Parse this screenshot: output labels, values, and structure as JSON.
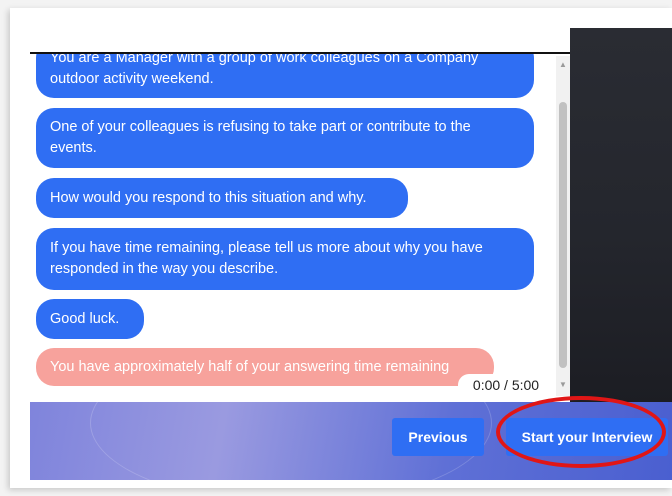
{
  "chat": {
    "messages": [
      {
        "text": "You are a Manager with a group of work colleagues on a Company outdoor activity weekend.",
        "kind": "info"
      },
      {
        "text": "One of your colleagues is refusing to take part or contribute to the events.",
        "kind": "info"
      },
      {
        "text": "How would you respond to this situation and why.",
        "kind": "info"
      },
      {
        "text": "If you have time remaining, please tell us more about why you have responded in the way you describe.",
        "kind": "info"
      },
      {
        "text": "Good luck.",
        "kind": "info"
      },
      {
        "text": "You have approximately half of your answering time remaining",
        "kind": "warning"
      }
    ]
  },
  "timer": {
    "label": "0:00 / 5:00"
  },
  "buttons": {
    "previous": "Previous",
    "start": "Start your Interview"
  },
  "colors": {
    "bubble": "#2f6ef3",
    "warning_bubble": "#f7a29c",
    "highlight_ring": "#e01616"
  }
}
